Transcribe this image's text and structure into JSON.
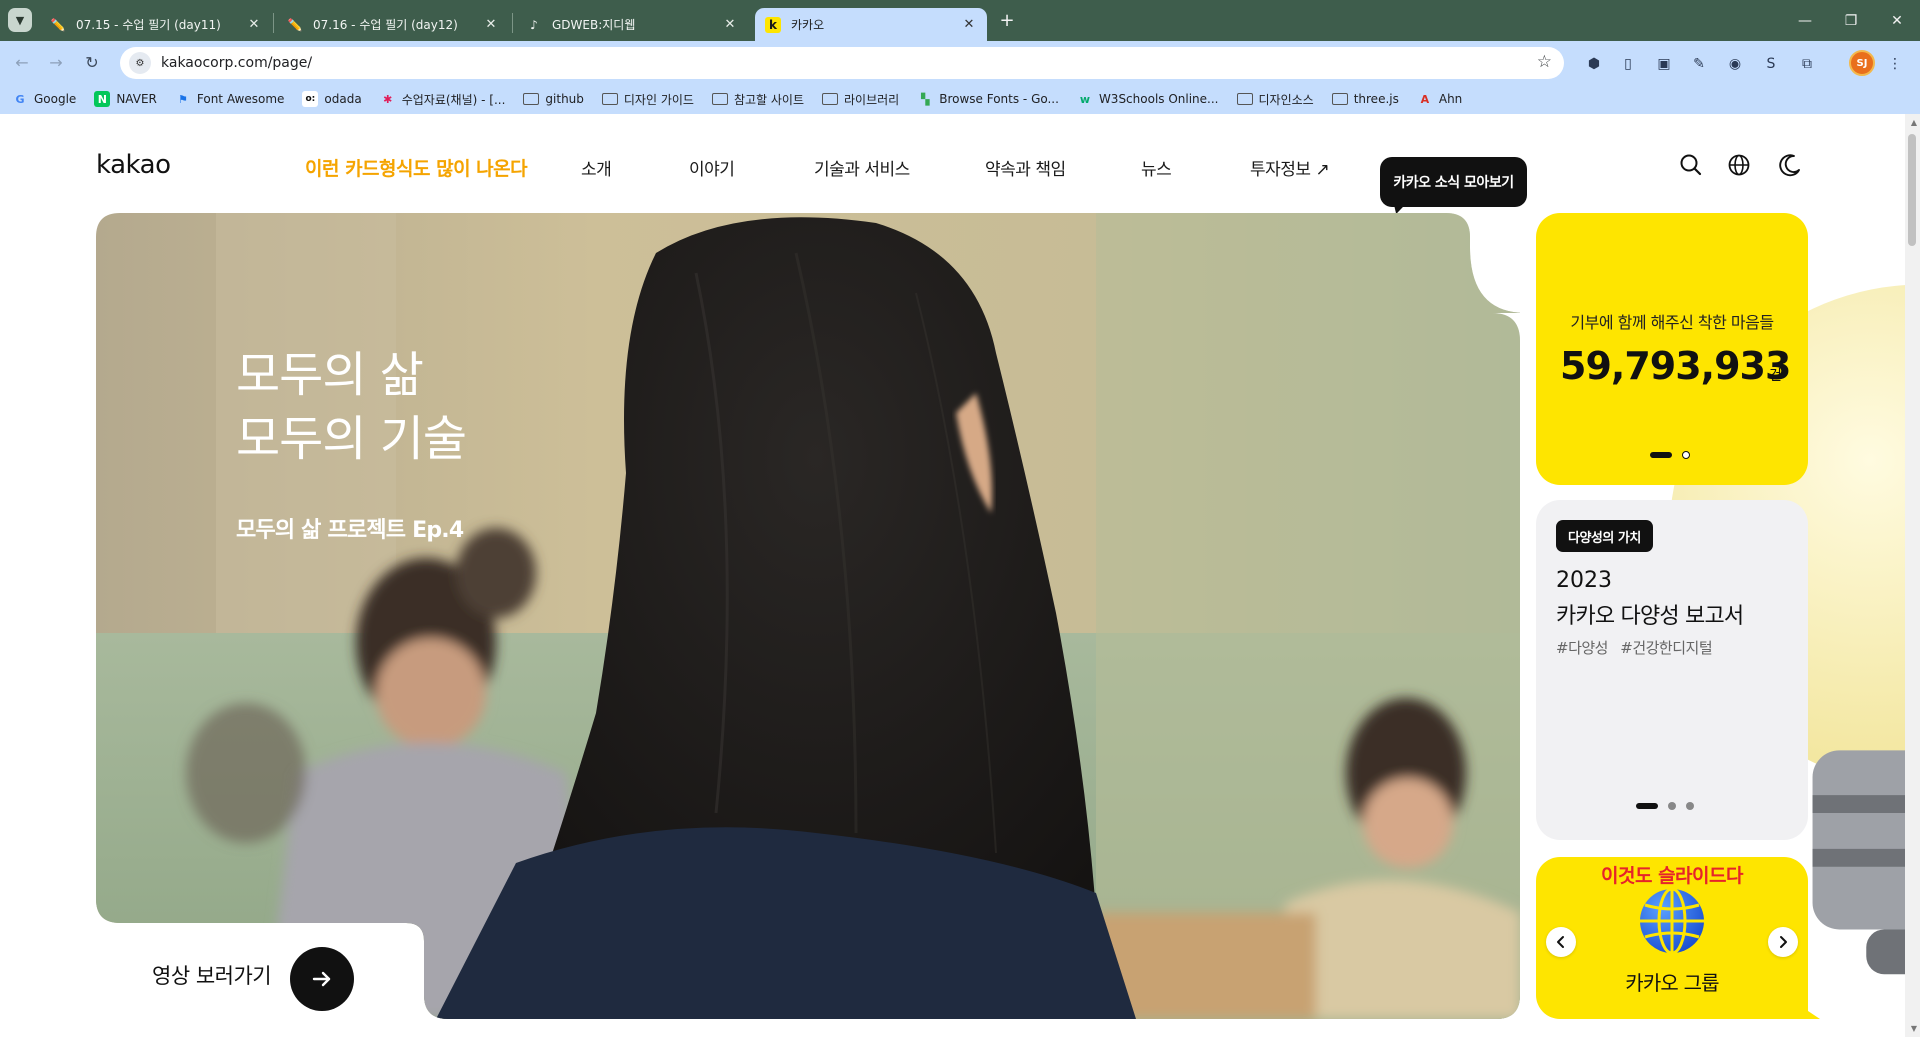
{
  "browser": {
    "tabs": [
      {
        "title": "07.15 - 수업 필기 (day11)",
        "icon": "pencil-icon"
      },
      {
        "title": "07.16 - 수업 필기 (day12)",
        "icon": "pencil-icon"
      },
      {
        "title": "GDWEB:지디웹",
        "icon": "gdweb-icon"
      },
      {
        "title": "카카오",
        "icon": "kakao-k-icon",
        "favicon_text": "k",
        "active": true
      }
    ],
    "new_tab": "+",
    "url": "kakaocorp.com/page/",
    "profile_initials": "SJ",
    "bookmarks": [
      {
        "label": "Google",
        "icon": "google-icon",
        "glyph": "G"
      },
      {
        "label": "NAVER",
        "icon": "naver-icon",
        "glyph": "N"
      },
      {
        "label": "Font Awesome",
        "icon": "flag-icon",
        "glyph": "⚑"
      },
      {
        "label": "odada",
        "icon": "odada-icon",
        "glyph": "o:"
      },
      {
        "label": "수업자료(채널) - [...",
        "icon": "slack-icon",
        "glyph": "✱"
      },
      {
        "label": "github",
        "icon": "folder-icon",
        "glyph": ""
      },
      {
        "label": "디자인 가이드",
        "icon": "folder-icon",
        "glyph": ""
      },
      {
        "label": "참고할 사이트",
        "icon": "folder-icon",
        "glyph": ""
      },
      {
        "label": "라이브러리",
        "icon": "folder-icon",
        "glyph": ""
      },
      {
        "label": "Browse Fonts - Go...",
        "icon": "google-fonts-icon",
        "glyph": "▚"
      },
      {
        "label": "W3Schools Online...",
        "icon": "w3schools-icon",
        "glyph": "w"
      },
      {
        "label": "디자인소스",
        "icon": "folder-icon",
        "glyph": ""
      },
      {
        "label": "three.js",
        "icon": "folder-icon",
        "glyph": ""
      },
      {
        "label": "Ahn",
        "icon": "ahn-icon",
        "glyph": "A"
      }
    ],
    "colors": {
      "tabbar": "#3e5d4c",
      "toolbar": "#c5ddfd"
    }
  },
  "site": {
    "logo": "kakao",
    "annotation_top": "이런 카드형식도 많이 나온다",
    "nav": [
      "소개",
      "이야기",
      "기술과 서비스",
      "약속과 책임",
      "뉴스",
      "투자정보 ↗"
    ],
    "tooltip": "카카오 소식 모아보기",
    "hero": {
      "title_line1": "모두의 삶",
      "title_line2": "모두의 기술",
      "subtitle": "모두의 삶 프로젝트 Ep.4",
      "video_link": "영상 보러가기"
    },
    "donation": {
      "label": "기부에 함께 해주신 착한 마음들",
      "count": "59,793,933",
      "unit": "건"
    },
    "report": {
      "badge": "다양성의 가치",
      "year": "2023",
      "title": "카카오 다양성 보고서",
      "tags": [
        "#다양성",
        "#건강한디지털"
      ]
    },
    "group": {
      "annotation": "이것도 슬라이드다",
      "label": "카카오 그룹"
    },
    "colors": {
      "brand_yellow": "#fee500",
      "annotation_orange": "#f5a400",
      "annotation_red": "#e6232a"
    }
  }
}
